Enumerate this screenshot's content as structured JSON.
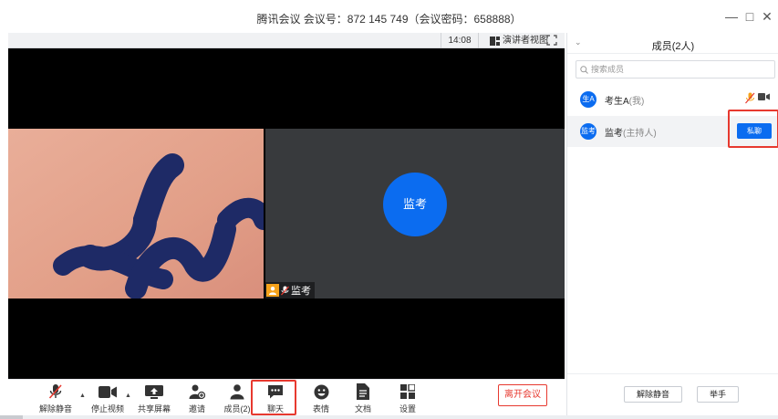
{
  "window": {
    "title": "腾讯会议 会议号：872 145 749（会议密码：658888）",
    "minimize": "—",
    "maximize": "□",
    "close": "✕"
  },
  "topbar": {
    "time": "14:08",
    "view_label": "演讲者视图"
  },
  "video": {
    "host_avatar": "监考",
    "host_tag": "监考"
  },
  "toolbar": {
    "unmute": "解除静音",
    "stop_video": "停止视频",
    "share_screen": "共享屏幕",
    "invite": "邀请",
    "members": "成员(2)",
    "chat": "聊天",
    "reactions": "表情",
    "docs": "文档",
    "settings": "设置",
    "leave": "离开会议"
  },
  "panel": {
    "title": "成员(2人)",
    "search_placeholder": "搜索成员",
    "members": [
      {
        "avatar": "生A",
        "name": "考生A",
        "role": "(我)"
      },
      {
        "avatar": "监考",
        "name": "监考",
        "role": "(主持人)",
        "action": "私聊"
      }
    ],
    "footer": {
      "unmute": "解除静音",
      "raise_hand": "举手"
    }
  },
  "colors": {
    "accent": "#0b6cf0",
    "highlight_red": "#e7392f",
    "dark_tile": "#383a3d"
  }
}
